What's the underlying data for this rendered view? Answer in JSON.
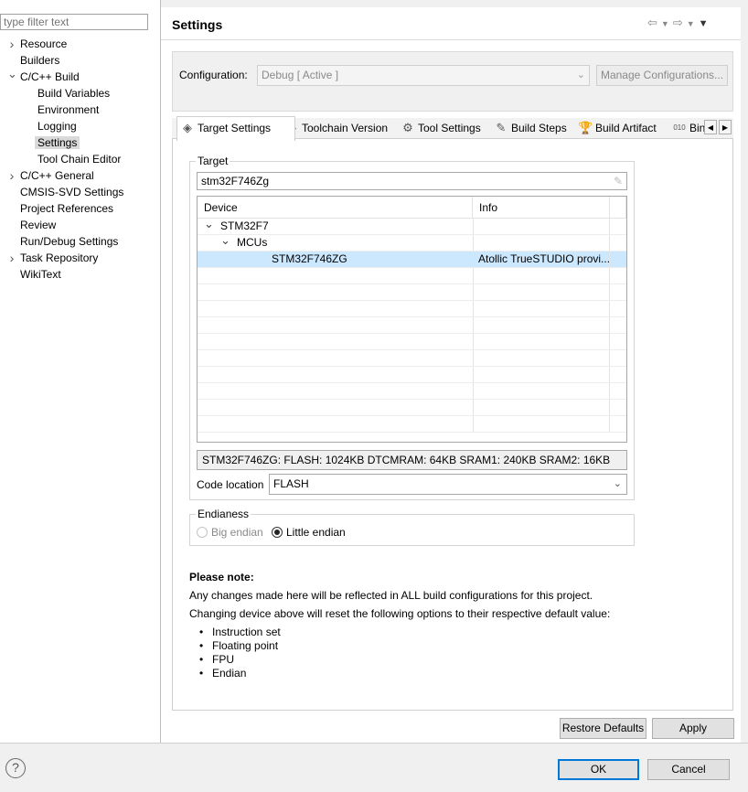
{
  "filter": {
    "placeholder": "type filter text"
  },
  "tree": [
    {
      "label": "Resource",
      "expander": ">",
      "indent": 0
    },
    {
      "label": "Builders",
      "expander": "",
      "indent": 0
    },
    {
      "label": "C/C++ Build",
      "expander": "v",
      "indent": 0
    },
    {
      "label": "Build Variables",
      "expander": "",
      "indent": 1
    },
    {
      "label": "Environment",
      "expander": "",
      "indent": 1
    },
    {
      "label": "Logging",
      "expander": "",
      "indent": 1
    },
    {
      "label": "Settings",
      "expander": "",
      "indent": 1,
      "selected": true
    },
    {
      "label": "Tool Chain Editor",
      "expander": "",
      "indent": 1
    },
    {
      "label": "C/C++ General",
      "expander": ">",
      "indent": 0
    },
    {
      "label": "CMSIS-SVD Settings",
      "expander": "",
      "indent": 0
    },
    {
      "label": "Project References",
      "expander": "",
      "indent": 0
    },
    {
      "label": "Review",
      "expander": "",
      "indent": 0
    },
    {
      "label": "Run/Debug Settings",
      "expander": "",
      "indent": 0
    },
    {
      "label": "Task Repository",
      "expander": ">",
      "indent": 0
    },
    {
      "label": "WikiText",
      "expander": "",
      "indent": 0
    }
  ],
  "page": {
    "title": "Settings"
  },
  "configuration": {
    "label": "Configuration:",
    "value": "Debug  [ Active ]",
    "manage_label": "Manage Configurations..."
  },
  "tabs": [
    {
      "label": "Target Settings",
      "icon": "target-settings-icon",
      "active": true
    },
    {
      "label": "Toolchain Version",
      "icon": "toolchain-icon"
    },
    {
      "label": "Tool Settings",
      "icon": "tool-settings-icon"
    },
    {
      "label": "Build Steps",
      "icon": "build-steps-icon"
    },
    {
      "label": "Build Artifact",
      "icon": "build-artifact-icon"
    },
    {
      "label": "Bin",
      "icon": "binary-icon"
    }
  ],
  "target": {
    "group_label": "Target",
    "search_value": "stm32F746Zg",
    "columns": [
      "Device",
      "Info"
    ],
    "rows": [
      {
        "device": "STM32F7",
        "info": "",
        "level": 0,
        "expander": "v"
      },
      {
        "device": "MCUs",
        "info": "",
        "level": 1,
        "expander": "v"
      },
      {
        "device": "STM32F746ZG",
        "info": "Atollic TrueSTUDIO provi...",
        "level": 2,
        "selected": true
      }
    ],
    "info_text": "STM32F746ZG: FLASH: 1024KB DTCMRAM: 64KB SRAM1: 240KB SRAM2: 16KB",
    "code_location_label": "Code location",
    "code_location_value": "FLASH"
  },
  "endianess": {
    "group_label": "Endianess",
    "big_label": "Big endian",
    "little_label": "Little endian",
    "selected": "little"
  },
  "note": {
    "heading": "Please note:",
    "line1": "Any changes made here will be reflected in ALL build configurations for this project.",
    "line2": "Changing device above will reset the following options to their respective default value:",
    "bullets": [
      "Instruction set",
      "Floating point",
      "FPU",
      "Endian"
    ]
  },
  "buttons": {
    "restore": "Restore Defaults",
    "apply": "Apply",
    "ok": "OK",
    "cancel": "Cancel"
  }
}
